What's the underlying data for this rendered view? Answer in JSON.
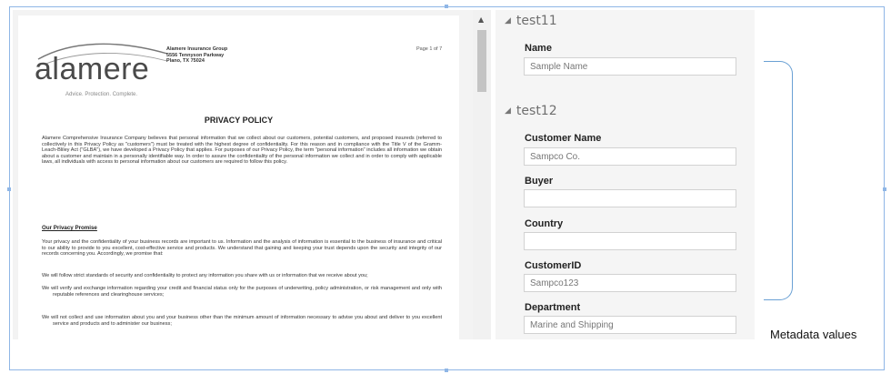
{
  "document": {
    "logo_word": "alamere",
    "logo_tagline": "Advice. Protection. Complete.",
    "company_address": [
      "Alamere Insurance Group",
      "5556 Tennyson Parkway",
      "Plano, TX 75024"
    ],
    "page_number": "Page 1 of 7",
    "title": "PRIVACY POLICY",
    "intro_paragraph": "Alamere Comprehensive Insurance Company believes that personal information that we collect about our customers, potential customers, and proposed insureds (referred to collectively in this Privacy Policy as \"customers\") must be treated with the highest degree of confidentiality. For this reason and in compliance with the Title V of the Gramm-Leach-Bliley Act (\"GLBA\"), we have developed a Privacy Policy that applies. For purposes of our Privacy Policy, the term \"personal information\" includes all information we obtain about a customer and maintain in a personally identifiable way. In order to assure the confidentiality of the personal information we collect and in order to comply with applicable laws, all individuals with access to personal information about our customers are required to follow this policy.",
    "section_heading": "Our Privacy Promise",
    "promise_paragraph": "Your privacy and the confidentiality of your business records are important to us. Information and the analysis of information is essential to the business of insurance and critical to our ability to provide to you excellent, cost-effective service and products. We understand that gaining and keeping your trust depends upon the security and integrity of our records concerning you. Accordingly, we promise that:",
    "bullets": [
      "We will follow strict standards of security and confidentiality to protect any information you share with us or information that we receive about you;",
      "We will verify and exchange information regarding your credit and financial status only for the purposes of underwriting, policy administration, or risk management and only with reputable references and clearinghouse services;",
      "We will not collect and use information about you and your business other than the minimum amount of information necessary to advise you about and deliver to you excellent service and products and to administer our business;"
    ]
  },
  "metadata_panel": {
    "groups": [
      {
        "title": "test11",
        "fields": [
          {
            "label": "Name",
            "value": "Sample Name"
          }
        ]
      },
      {
        "title": "test12",
        "fields": [
          {
            "label": "Customer Name",
            "value": "Sampco Co."
          },
          {
            "label": "Buyer",
            "value": ""
          },
          {
            "label": "Country",
            "value": ""
          },
          {
            "label": "CustomerID",
            "value": "Sampco123"
          },
          {
            "label": "Department",
            "value": "Marine and Shipping"
          }
        ]
      }
    ]
  },
  "annotation": {
    "label": "Metadata values"
  },
  "icons": {
    "collapse": "collapse-triangle-icon",
    "scroll_up": "scroll-up-arrow-icon"
  },
  "colors": {
    "accent": "#6aa0d4",
    "frame": "#8fb6e6"
  }
}
